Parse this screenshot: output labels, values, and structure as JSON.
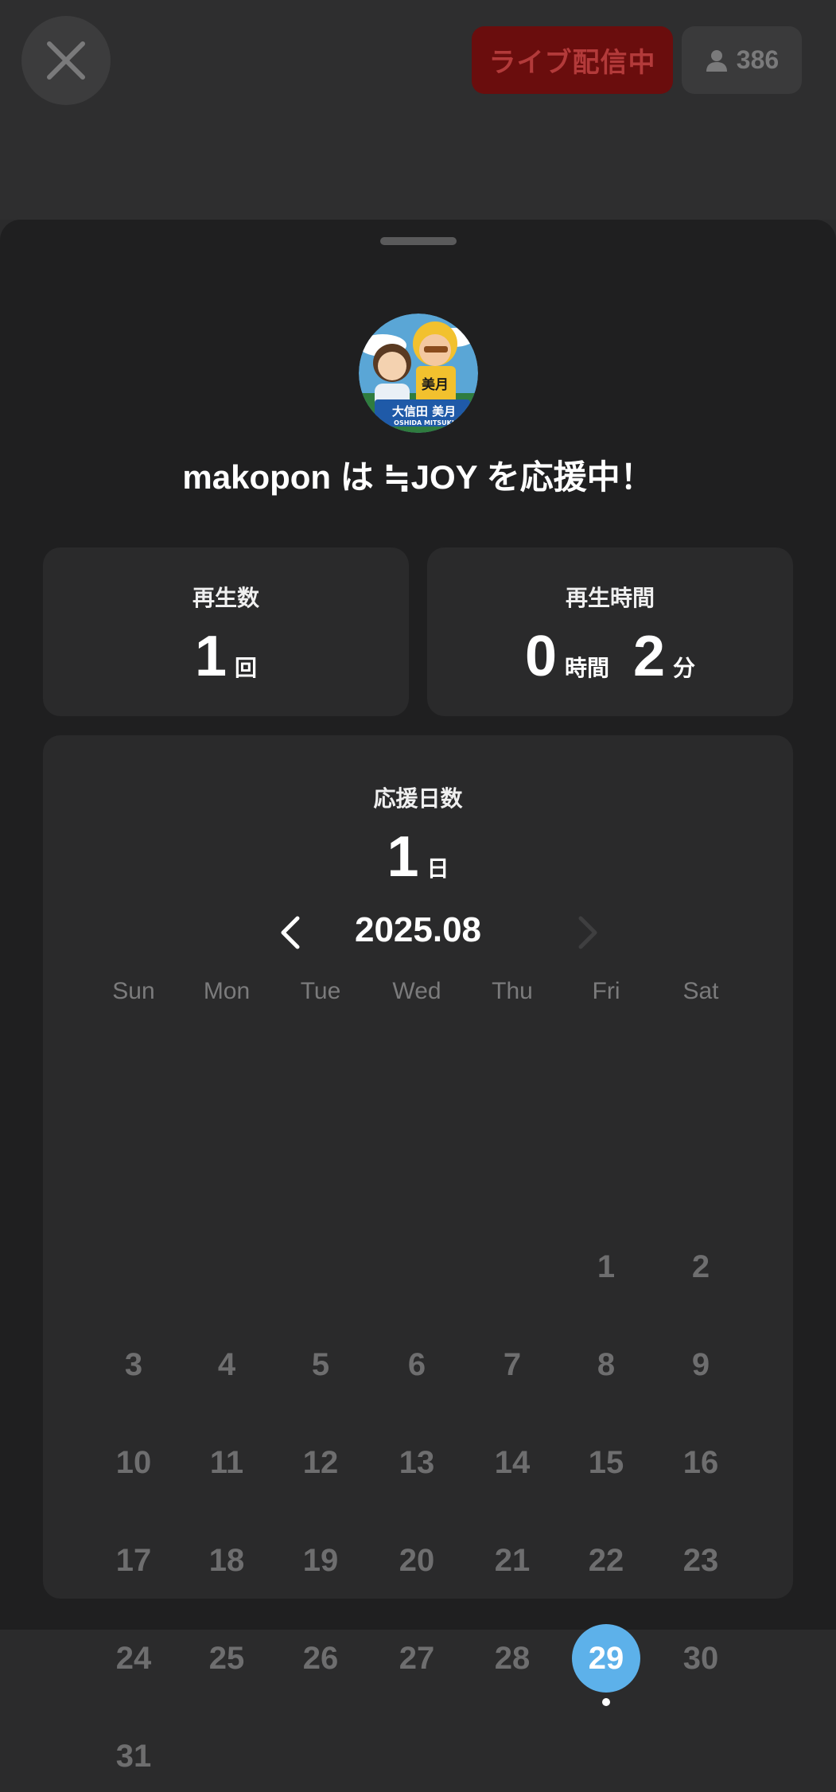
{
  "header": {
    "live_label": "ライブ配信中",
    "viewer_count": "386",
    "icons": {
      "close": "close-icon",
      "viewer": "person-icon"
    }
  },
  "profile": {
    "avatar_badge_text": "大信田 美月",
    "avatar_badge_subtext": "OSHIDA MITSUKI",
    "avatar_shirt_text": "美月",
    "headline": "makopon は ≒JOY を応援中！"
  },
  "stats": {
    "plays": {
      "title": "再生数",
      "value": "1",
      "unit": "回"
    },
    "playtime": {
      "title": "再生時間",
      "hours": "0",
      "hours_unit": "時間",
      "minutes": "2",
      "minutes_unit": "分"
    }
  },
  "support": {
    "title": "応援日数",
    "value": "1",
    "unit": "日"
  },
  "calendar": {
    "month_label": "2025.08",
    "weekdays": [
      "Sun",
      "Mon",
      "Tue",
      "Wed",
      "Thu",
      "Fri",
      "Sat"
    ],
    "first_weekday_index": 5,
    "days_in_month": 31,
    "selected_day": 29,
    "marked_days": [
      29
    ],
    "selected_color": "#5db1ea",
    "icons": {
      "prev": "chevron-left-icon",
      "next": "chevron-right-icon"
    }
  }
}
